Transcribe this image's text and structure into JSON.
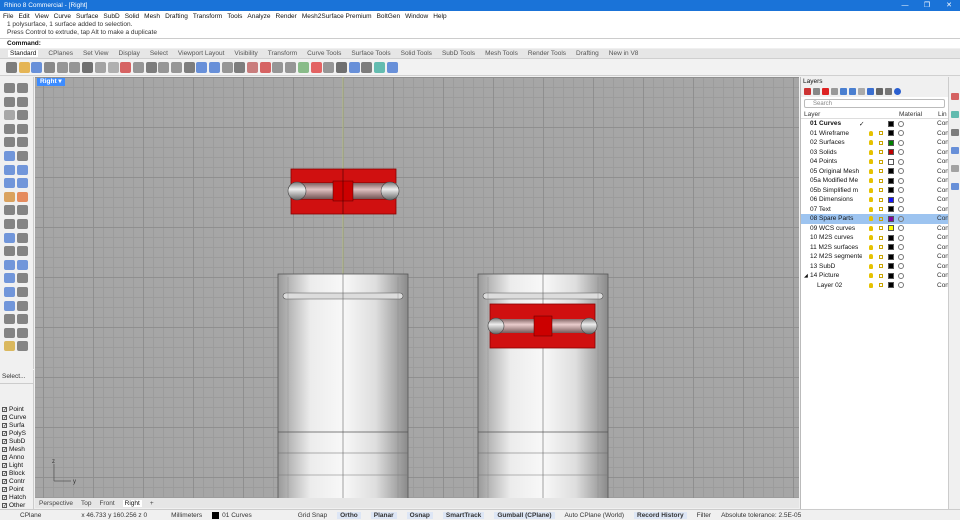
{
  "window": {
    "title": "Rhino 8 Commercial - [Right]"
  },
  "menu": [
    "File",
    "Edit",
    "View",
    "Curve",
    "Surface",
    "SubD",
    "Solid",
    "Mesh",
    "Drafting",
    "Transform",
    "Tools",
    "Analyze",
    "Render",
    "Mesh2Surface Premium",
    "BoltGen",
    "Window",
    "Help"
  ],
  "history": [
    "1 polysurface, 1 surface added to selection.",
    "Press Control to extrude, tap Alt to make a duplicate"
  ],
  "command": {
    "label": "Command:"
  },
  "toolbar_tabs": [
    "Standard",
    "CPlanes",
    "Set View",
    "Display",
    "Select",
    "Viewport Layout",
    "Visibility",
    "Transform",
    "Curve Tools",
    "Surface Tools",
    "Solid Tools",
    "SubD Tools",
    "Mesh Tools",
    "Render Tools",
    "Drafting",
    "New in V8"
  ],
  "viewport": {
    "label": "Right ▾"
  },
  "view_tabs": [
    "Perspective",
    "Top",
    "Front",
    "Right",
    "+"
  ],
  "select_panel": {
    "title": "Select...",
    "filters": [
      "Point",
      "Curve",
      "Surfa",
      "PolyS",
      "SubD",
      "Mesh",
      "Anno",
      "Light",
      "Block",
      "Contr",
      "Point",
      "Hatch",
      "Other"
    ]
  },
  "layers_panel": {
    "title": "Layers",
    "search_placeholder": "Search",
    "columns": {
      "layer": "Layer",
      "material": "Material",
      "linetype": "Lin"
    },
    "rows": [
      {
        "name": "01 Curves",
        "color": "#000000",
        "current": true,
        "selected": false
      },
      {
        "name": "01 Wireframe",
        "color": "#000000",
        "current": false,
        "selected": false
      },
      {
        "name": "02 Surfaces",
        "color": "#008000",
        "current": false,
        "selected": false
      },
      {
        "name": "03 Solids",
        "color": "#c00000",
        "current": false,
        "selected": false
      },
      {
        "name": "04 Points",
        "color": "#ffffff",
        "current": false,
        "selected": false
      },
      {
        "name": "05 Original Mesh",
        "color": "#000000",
        "current": false,
        "selected": false
      },
      {
        "name": "05a Modified Me",
        "color": "#000000",
        "current": false,
        "selected": false
      },
      {
        "name": "05b Simplified m",
        "color": "#000000",
        "current": false,
        "selected": false
      },
      {
        "name": "06 Dimensions",
        "color": "#1515ff",
        "current": false,
        "selected": false
      },
      {
        "name": "07 Text",
        "color": "#000000",
        "current": false,
        "selected": false
      },
      {
        "name": "08 Spare Parts",
        "color": "#8000a0",
        "current": false,
        "selected": true
      },
      {
        "name": "09 WCS curves",
        "color": "#ffff00",
        "current": false,
        "selected": false
      },
      {
        "name": "10 M2S curves",
        "color": "#000000",
        "current": false,
        "selected": false
      },
      {
        "name": "11 M2S surfaces",
        "color": "#000000",
        "current": false,
        "selected": false
      },
      {
        "name": "12 M2S segmente",
        "color": "#000000",
        "current": false,
        "selected": false
      },
      {
        "name": "13 SubD",
        "color": "#000000",
        "current": false,
        "selected": false
      },
      {
        "name": "14 Picture",
        "color": "#000000",
        "current": false,
        "selected": false
      },
      {
        "name": "Layer 02",
        "color": "#000000",
        "current": false,
        "selected": false
      }
    ],
    "linetype_value": "Con"
  },
  "status": {
    "cplane": "CPlane",
    "coords": "x 46.733  y 160.256  z 0",
    "units": "Millimeters",
    "layer": "01 Curves",
    "grid_snap": "Grid Snap",
    "ortho": "Ortho",
    "planar": "Planar",
    "osnap": "Osnap",
    "smarttrack": "SmartTrack",
    "gumball": "Gumball (CPlane)",
    "auto_cplane": "Auto CPlane (World)",
    "record_history": "Record History",
    "filter": "Filter",
    "tolerance": "Absolute tolerance: 2.5E-05"
  },
  "colors": {
    "accent": "#1a73d8",
    "selection_red": "#d01010",
    "viewport_bg": "#a6a6a6"
  }
}
